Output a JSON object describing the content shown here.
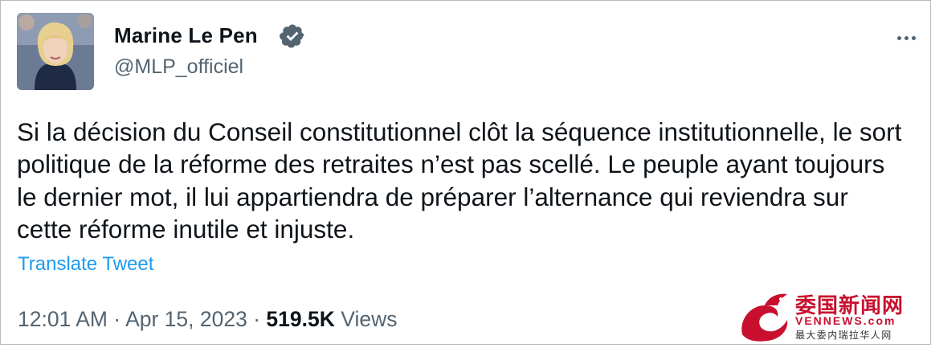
{
  "tweet": {
    "author_name": "Marine Le Pen",
    "author_handle": "@MLP_officiel",
    "text": "Si la décision du Conseil constitutionnel clôt la séquence institutionnelle, le sort politique de la réforme des retraites n’est pas scellé. Le peuple ayant toujours le dernier mot, il lui appartiendra de préparer l’alternance qui reviendra sur cette réforme inutile et injuste.",
    "translate_label": "Translate Tweet",
    "time": "12:01 AM",
    "separator": "·",
    "date": "Apr 15, 2023",
    "views_count": "519.5K",
    "views_label": "Views"
  },
  "icons": {
    "verified": "verified-badge-icon",
    "more": "more-options-icon"
  },
  "colors": {
    "accent": "#1d9bf0",
    "secondary_text": "#536471",
    "primary_text": "#0f1419",
    "watermark": "#c8102e"
  },
  "watermark": {
    "title": "委国新闻网",
    "url": "VENNEWS.com",
    "tagline": "最大委内瑞拉华人网"
  }
}
